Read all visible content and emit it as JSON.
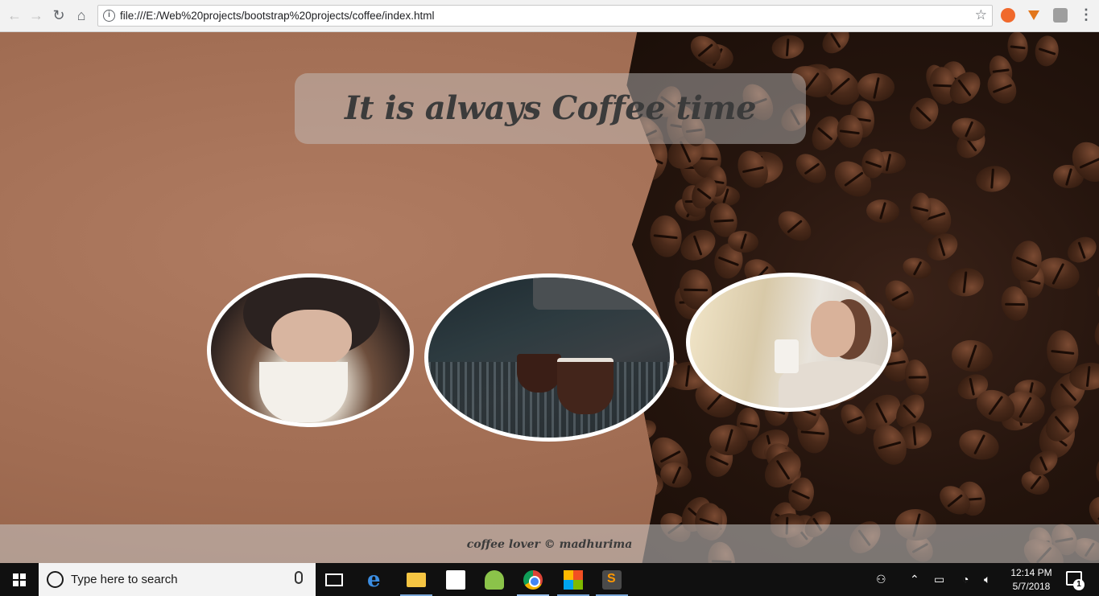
{
  "browser": {
    "url": "file:///E:/Web%20projects/bootstrap%20projects/coffee/index.html",
    "icons": [
      "back-arrow",
      "forward-arrow",
      "reload",
      "home",
      "info",
      "star",
      "extension-orange",
      "metamask-fox",
      "extension-gray",
      "menu-dots"
    ]
  },
  "page": {
    "title": "It is always Coffee time",
    "footer": "coffee lover © madhurima",
    "images": [
      "woman-drinking-coffee",
      "espresso-machine-cups",
      "woman-smelling-coffee"
    ]
  },
  "taskbar": {
    "search_placeholder": "Type here to search",
    "time": "12:14 PM",
    "date": "5/7/2018",
    "notification_count": "1",
    "apps": [
      "task-view",
      "edge",
      "file-explorer",
      "store",
      "android-studio",
      "chrome",
      "microsoft-app",
      "sublime-text"
    ]
  },
  "colors": {
    "paper": "#a8745a",
    "beans": "#24140d",
    "title_text": "#3b3b3b",
    "taskbar": "#101010"
  }
}
